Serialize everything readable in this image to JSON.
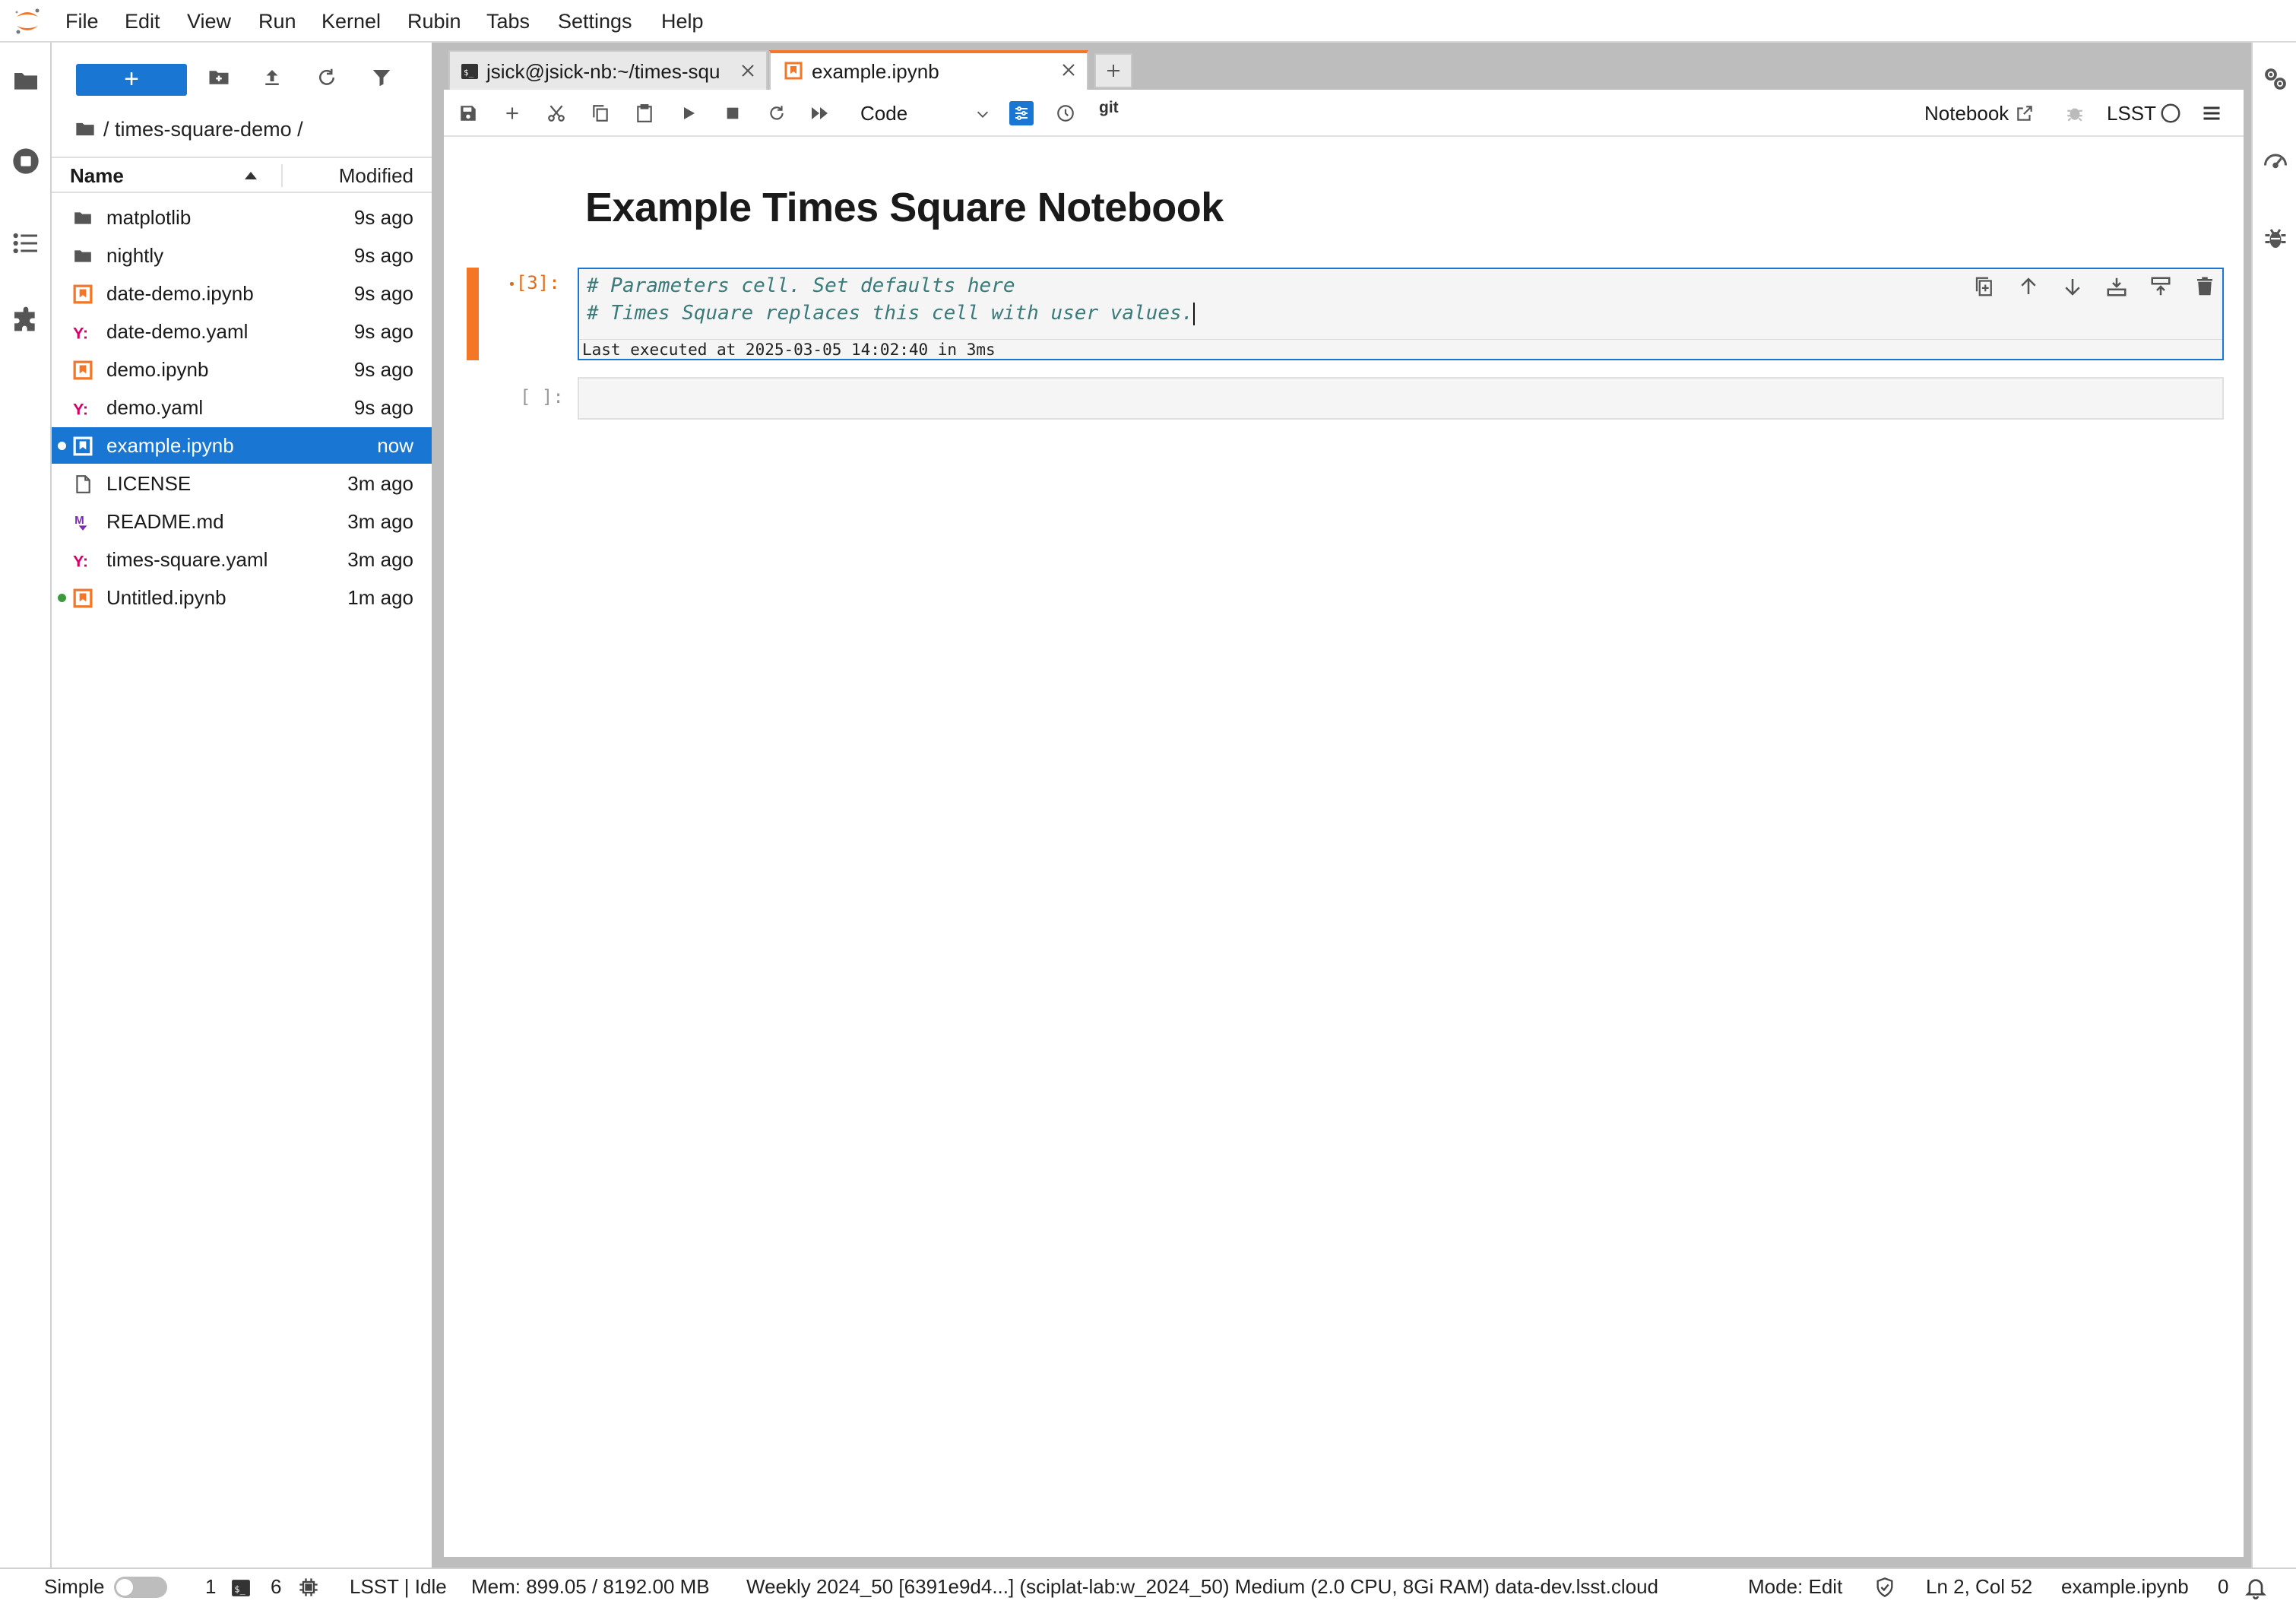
{
  "menubar": {
    "items": [
      "File",
      "Edit",
      "View",
      "Run",
      "Kernel",
      "Rubin",
      "Tabs",
      "Settings",
      "Help"
    ]
  },
  "filebrowser": {
    "new_label": "+",
    "breadcrumb": "/ times-square-demo /",
    "col_name": "Name",
    "col_modified": "Modified",
    "files": [
      {
        "name": "matplotlib",
        "modified": "9s ago",
        "type": "folder"
      },
      {
        "name": "nightly",
        "modified": "9s ago",
        "type": "folder"
      },
      {
        "name": "date-demo.ipynb",
        "modified": "9s ago",
        "type": "notebook"
      },
      {
        "name": "date-demo.yaml",
        "modified": "9s ago",
        "type": "yaml"
      },
      {
        "name": "demo.ipynb",
        "modified": "9s ago",
        "type": "notebook"
      },
      {
        "name": "demo.yaml",
        "modified": "9s ago",
        "type": "yaml"
      },
      {
        "name": "example.ipynb",
        "modified": "now",
        "type": "notebook",
        "selected": true,
        "running": true
      },
      {
        "name": "LICENSE",
        "modified": "3m ago",
        "type": "file"
      },
      {
        "name": "README.md",
        "modified": "3m ago",
        "type": "markdown"
      },
      {
        "name": "times-square.yaml",
        "modified": "3m ago",
        "type": "yaml"
      },
      {
        "name": "Untitled.ipynb",
        "modified": "1m ago",
        "type": "notebook",
        "running_green": true
      }
    ]
  },
  "tabs": [
    {
      "label": "jsick@jsick-nb:~/times-squ",
      "icon": "terminal-icon"
    },
    {
      "label": "example.ipynb",
      "icon": "notebook-icon",
      "active": true
    }
  ],
  "notebook": {
    "cell_type": "Code",
    "git_label": "git",
    "notebook_label": "Notebook",
    "kernel_name": "LSST",
    "title": "Example Times Square Notebook",
    "cell1": {
      "prompt": "[3]:",
      "line1": "# Parameters cell. Set defaults here",
      "line2": "# Times Square replaces this cell with user values.",
      "exec_info": "Last executed at 2025-03-05 14:02:40 in 3ms"
    },
    "cell2": {
      "prompt": "[ ]:"
    }
  },
  "statusbar": {
    "mode_label": "Simple",
    "terminals_count": "1",
    "kernels_count": "6",
    "kernel_status": "LSST | Idle",
    "memory": "Mem: 899.05 / 8192.00 MB",
    "image_info": "Weekly 2024_50 [6391e9d4...] (sciplat-lab:w_2024_50) Medium (2.0 CPU, 8Gi RAM) data-dev.lsst.cloud",
    "edit_mode": "Mode: Edit",
    "cursor_pos": "Ln 2, Col 52",
    "filename": "example.ipynb",
    "notifications": "0"
  },
  "colors": {
    "accent_blue": "#1976d2",
    "jupyter_orange": "#f37726",
    "yaml_magenta": "#d6006a",
    "markdown_purple": "#7b2bb0"
  }
}
